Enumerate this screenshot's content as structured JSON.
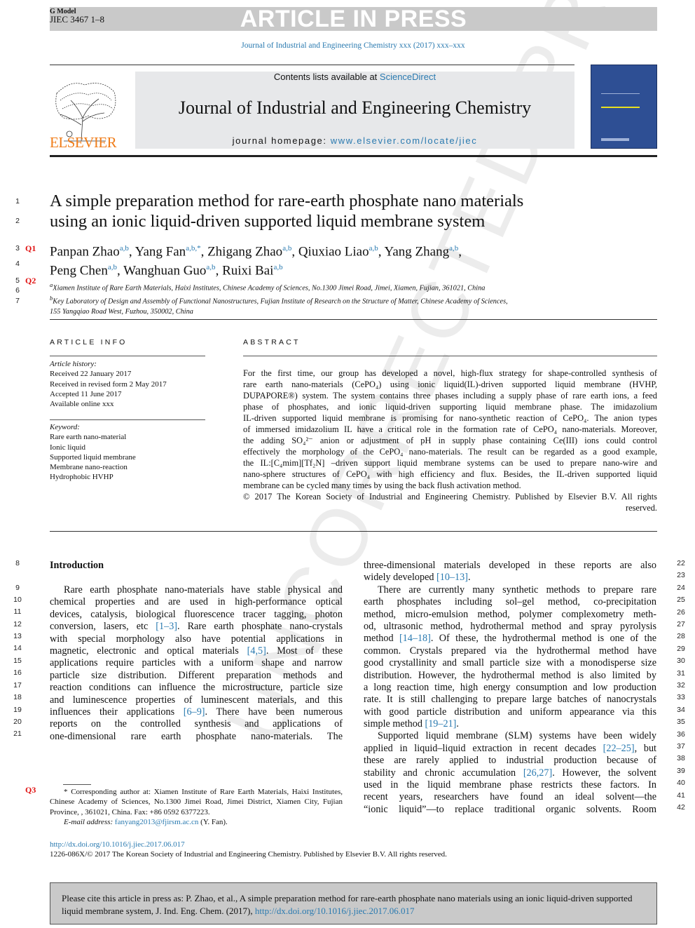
{
  "header": {
    "g_model": "G Model",
    "article_code": "JIEC 3467 1–8",
    "banner": "ARTICLE IN PRESS",
    "journal_ref": "Journal of Industrial and Engineering Chemistry xxx (2017) xxx–xxx",
    "contents_prefix": "Contents lists available at ",
    "sciencedirect": "ScienceDirect",
    "journal_title": "Journal of Industrial and Engineering Chemistry",
    "homepage_prefix": "journal homepage: ",
    "homepage_url": "www.elsevier.com/locate/jiec",
    "publisher_logo": "ELSEVIER"
  },
  "article": {
    "title_lines": [
      "A simple preparation method for rare-earth phosphate nano materials",
      "using an ionic liquid-driven supported liquid membrane system"
    ],
    "queries": [
      "Q1",
      "Q2",
      "Q3"
    ],
    "authors_line1": [
      {
        "name": "Panpan Zhao",
        "aff": "a,b"
      },
      {
        "name": "Yang Fan",
        "aff": "a,b,*"
      },
      {
        "name": "Zhigang Zhao",
        "aff": "a,b"
      },
      {
        "name": "Qiuxiao Liao",
        "aff": "a,b"
      },
      {
        "name": "Yang Zhang",
        "aff": "a,b"
      }
    ],
    "authors_line2": [
      {
        "name": "Peng Chen",
        "aff": "a,b"
      },
      {
        "name": "Wanghuan Guo",
        "aff": "a,b"
      },
      {
        "name": "Ruixi Bai",
        "aff": "a,b"
      }
    ],
    "affiliations": {
      "a": "Xiamen Institute of Rare Earth Materials, Haixi Institutes, Chinese Academy of Sciences, No.1300 Jimei Road, Jimei, Xiamen, Fujian, 361021, China",
      "b1": "Key Laboratory of Design and Assembly of Functional Nanostructures, Fujian Institute of Research on the Structure of Matter, Chinese Academy of Sciences,",
      "b2": "155 Yangqiao Road West, Fuzhou, 350002, China"
    }
  },
  "article_info": {
    "heading": "ARTICLE INFO",
    "history_label": "Article history:",
    "history": [
      "Received 22 January 2017",
      "Received in revised form 2 May 2017",
      "Accepted 11 June 2017",
      "Available online xxx"
    ],
    "keyword_label": "Keyword:",
    "keywords": [
      "Rare earth nano-material",
      "Ionic liquid",
      "Supported liquid membrane",
      "Membrane nano-reaction",
      "Hydrophobic HVHP"
    ]
  },
  "abstract": {
    "heading": "ABSTRACT",
    "lines": [
      "For the first time, our group has developed a novel, high-flux strategy for shape-controlled synthesis of",
      "rare earth nano-materials (CePO₄) using ionic liquid(IL)-driven supported liquid membrane (HVHP,",
      "DUPAPORE®) system. The system contains three phases including a supply phase of rare earth ions, a feed",
      "phase of phosphates, and ionic liquid-driven supporting liquid membrane phase. The imidazolium",
      "IL-driven supported liquid membrane is promising for nano-synthetic reaction of CePO₄. The anion types",
      "of immersed imidazolium IL have a critical role in the formation rate of CePO₄ nano-materials. Moreover,",
      "the adding SO₄²⁻ anion or adjustment of pH in supply phase containing Ce(III) ions could control",
      "effectively the morphology of the CePO₄ nano-materials. The result can be regarded as a good example,",
      "the IL:[C₄mim][Tf₂N] –driven support liquid membrane systems can be used to prepare nano-wire and",
      "nano-sphere structures of CePO₄ with high efficiency and flux. Besides, the IL-driven supported liquid",
      "membrane can be cycled many times by using the back flush activation method."
    ],
    "copyright_line1": "© 2017 The Korean Society of Industrial and Engineering Chemistry. Published by Elsevier B.V. All rights",
    "copyright_line2": "reserved."
  },
  "body": {
    "intro_heading": "Introduction",
    "left_lines": [
      "Rare earth phosphate nano-materials have stable physical and",
      "chemical properties and are used in high-performance optical",
      "devices, catalysis, biological fluorescence tracer tagging, photon",
      "conversion, lasers, etc [1–3]. Rare earth phosphate nano-crystals",
      "with special morphology also have potential applications in",
      "magnetic, electronic and optical materials [4,5]. Most of these",
      "applications require particles with a uniform shape and narrow",
      "particle size distribution. Different preparation methods and",
      "reaction conditions can influence the microstructure, particle size",
      "and luminescence properties of luminescent materials, and this",
      "influences their applications [6–9]. There have been numerous",
      "reports on the controlled synthesis and applications of",
      "one-dimensional rare earth phosphate nano-materials. The"
    ],
    "right_lines": [
      "three-dimensional materials developed in these reports are also",
      "widely developed [10–13].",
      "There are currently many synthetic methods to prepare rare",
      "earth phosphates including sol–gel method, co-precipitation",
      "method, micro-emulsion method, polymer complexometry meth-",
      "od, ultrasonic method, hydrothermal method and spray pyrolysis",
      "method [14–18]. Of these, the hydrothermal method is one of the",
      "common. Crystals prepared via the hydrothermal method have",
      "good crystallinity and small particle size with a monodisperse size",
      "distribution. However, the hydrothermal method is also limited by",
      "a long reaction time, high energy consumption and low production",
      "rate. It is still challenging to prepare large batches of nanocrystals",
      "with good particle distribution and uniform appearance via this",
      "simple method [19–21].",
      "Supported liquid membrane (SLM) systems have been widely",
      "applied in liquid–liquid extraction in recent decades [22–25], but",
      "these are rarely applied to industrial production because of",
      "stability and chronic accumulation [26,27]. However, the solvent",
      "used in the liquid membrane phase restricts these factors. In",
      "recent years, researchers have found an ideal solvent—the",
      "“ionic liquid”—to replace traditional organic solvents. Room"
    ]
  },
  "line_numbers": [
    "1",
    "2",
    "3",
    "4",
    "5",
    "6",
    "7",
    "8",
    "9",
    "10",
    "11",
    "12",
    "13",
    "14",
    "15",
    "16",
    "17",
    "18",
    "19",
    "20",
    "21",
    "22",
    "23",
    "24",
    "25",
    "26",
    "27",
    "28",
    "29",
    "30",
    "31",
    "32",
    "33",
    "34",
    "35",
    "36",
    "37",
    "38",
    "39",
    "40",
    "41",
    "42"
  ],
  "footnote": {
    "corresponding": "* Corresponding author at: Xiamen Institute of Rare Earth Materials, Haixi Institutes, Chinese Academy of Sciences, No.1300 Jimei Road, Jimei District, Xiamen City, Fujian Province, , 361021, China. Fax: +86 0592 6377223.",
    "email_label": "E-mail address: ",
    "email": "fanyang2013@fjirsm.ac.cn",
    "email_suffix": " (Y. Fan).",
    "doi": "http://dx.doi.org/10.1016/j.jiec.2017.06.017",
    "issn_copyright": "1226-086X/© 2017 The Korean Society of Industrial and Engineering Chemistry. Published by Elsevier B.V. All rights reserved."
  },
  "cite_box": {
    "text": "Please cite this article in press as: P. Zhao, et al., A simple preparation method for rare-earth phosphate nano materials using an ionic liquid-driven supported liquid membrane system, J. Ind. Eng. Chem. (2017), ",
    "doi": "http://dx.doi.org/10.1016/j.jiec.2017.06.017"
  },
  "watermark": "UNCORRECTED PROOF",
  "colors": {
    "link": "#2a7ab0",
    "query": "#e01010",
    "elsevier_orange": "#f07d1a",
    "banner_gray": "#c9c9c9",
    "cover_blue": "#2e4f94"
  }
}
